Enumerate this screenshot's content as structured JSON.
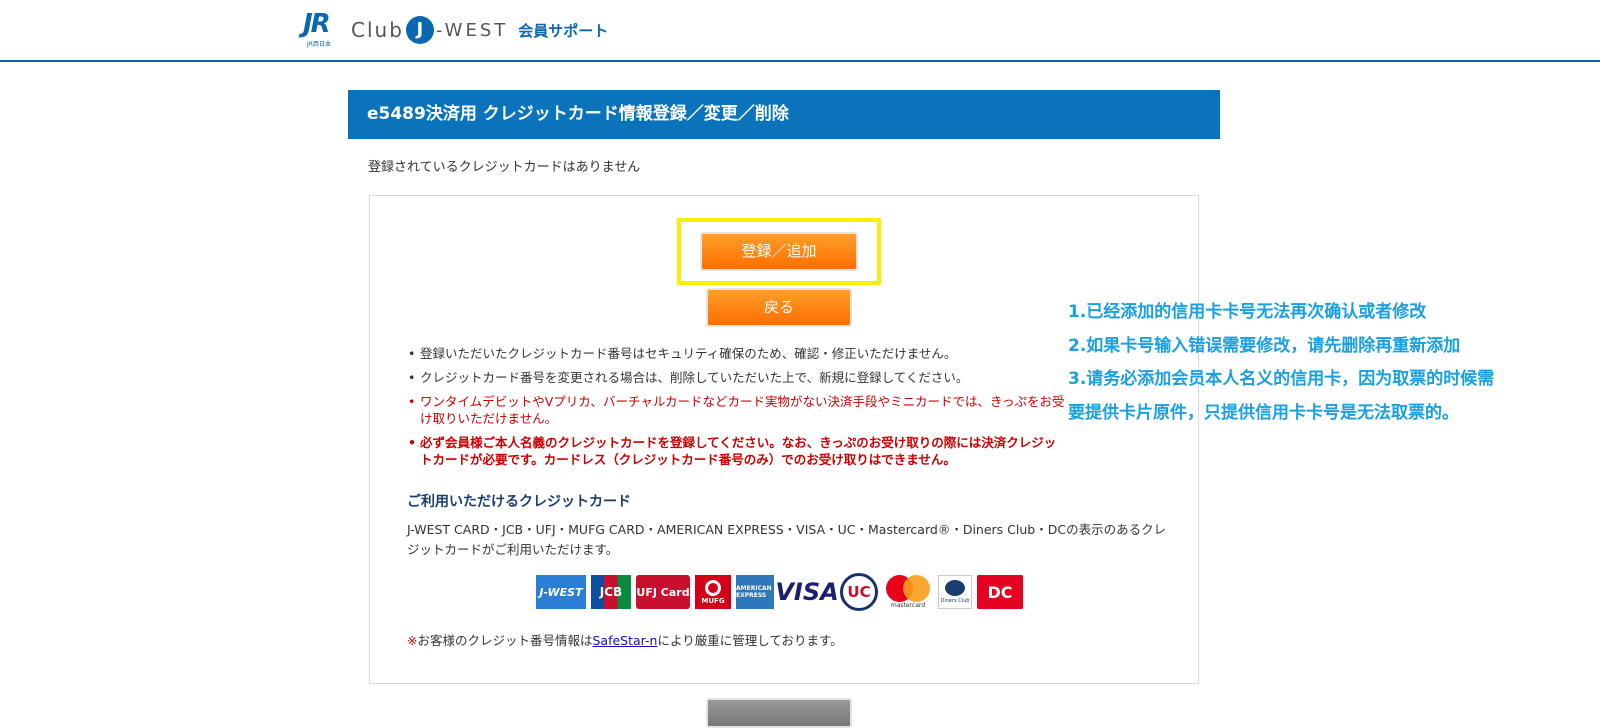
{
  "header": {
    "logo_jr": "JR",
    "logo_jr_sub": "JR西日本",
    "logo_club": "Club",
    "logo_j": "J",
    "logo_west": "-WEST",
    "logo_support": "会員サポート"
  },
  "title": "e5489決済用 クレジットカード情報登録／変更／削除",
  "no_card_message": "登録されているクレジットカードはありません",
  "buttons": {
    "register": "登録／追加",
    "back": "戻る"
  },
  "notes": [
    "登録いただいたクレジットカード番号はセキュリティ確保のため、確認・修正いただけません。",
    "クレジットカード番号を変更される場合は、削除していただいた上で、新規に登録してください。",
    "ワンタイムデビットやVプリカ、バーチャルカードなどカード実物がない決済手段やミニカードでは、きっぷをお受け取りいただけません。",
    "必ず会員様ご本人名義のクレジットカードを登録してください。なお、きっぷのお受け取りの際には決済クレジットカードが必要です。カードレス（クレジットカード番号のみ）でのお受け取りはできません。"
  ],
  "cards": {
    "heading": "ご利用いただけるクレジットカード",
    "description": "J-WEST CARD・JCB・UFJ・MUFG CARD・AMERICAN EXPRESS・VISA・UC・Mastercard®・Diners Club・DCの表示のあるクレジットカードがご利用いただけます。",
    "logos": {
      "jwest": "J-WEST",
      "jcb": "JCB",
      "ufj": "UFJ Card",
      "mufg": "MUFG",
      "amex": "AMERICAN EXPRESS",
      "visa": "VISA",
      "uc": "UC",
      "mastercard": "mastercard",
      "diners": "Diners Club",
      "dc": "DC"
    }
  },
  "safestar": {
    "mark": "※",
    "prefix": "お客様のクレジット番号情報は",
    "link": "SafeStar-n",
    "suffix": "により厳重に管理しております。"
  },
  "annotation": [
    "1.已经添加的信用卡卡号无法再次确认或者修改",
    "2.如果卡号输入错误需要修改，请先删除再重新添加",
    "3.请务必添加会员本人名义的信用卡，因为取票的时候需要提供卡片原件，只提供信用卡卡号是无法取票的。"
  ],
  "colors": {
    "brand_blue": "#0a73bb",
    "button_orange": "#ff7a00",
    "highlight_yellow": "#ffee00",
    "annotation_blue": "#1aa0e0",
    "warning_red": "#cc0000"
  }
}
